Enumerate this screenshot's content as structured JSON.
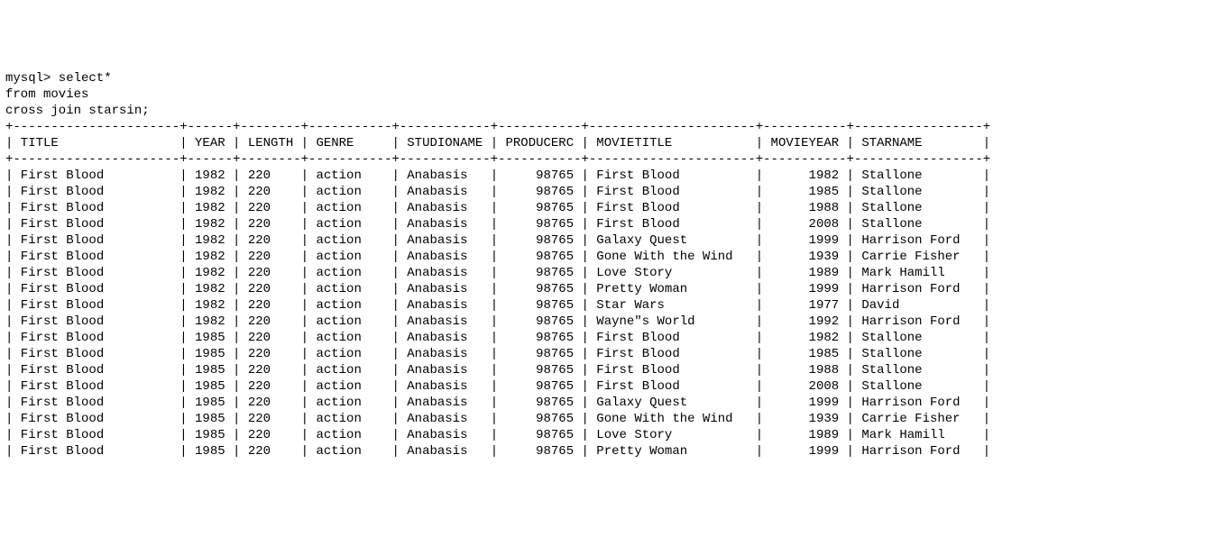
{
  "prompt": "mysql> ",
  "query_lines": [
    "select*",
    "from movies",
    "cross join starsin;"
  ],
  "columns": [
    {
      "name": "TITLE",
      "width": 20,
      "align": "left"
    },
    {
      "name": "YEAR",
      "width": 4,
      "align": "left"
    },
    {
      "name": "LENGTH",
      "width": 6,
      "align": "left"
    },
    {
      "name": "GENRE",
      "width": 9,
      "align": "left"
    },
    {
      "name": "STUDIONAME",
      "width": 10,
      "align": "left"
    },
    {
      "name": "PRODUCERC",
      "width": 9,
      "align": "right"
    },
    {
      "name": "MOVIETITLE",
      "width": 20,
      "align": "left"
    },
    {
      "name": "MOVIEYEAR",
      "width": 9,
      "align": "right"
    },
    {
      "name": "STARNAME",
      "width": 15,
      "align": "left"
    }
  ],
  "rows": [
    [
      "First Blood",
      "1982",
      "220",
      "action",
      "Anabasis",
      "98765",
      "First Blood",
      "1982",
      "Stallone"
    ],
    [
      "First Blood",
      "1982",
      "220",
      "action",
      "Anabasis",
      "98765",
      "First Blood",
      "1985",
      "Stallone"
    ],
    [
      "First Blood",
      "1982",
      "220",
      "action",
      "Anabasis",
      "98765",
      "First Blood",
      "1988",
      "Stallone"
    ],
    [
      "First Blood",
      "1982",
      "220",
      "action",
      "Anabasis",
      "98765",
      "First Blood",
      "2008",
      "Stallone"
    ],
    [
      "First Blood",
      "1982",
      "220",
      "action",
      "Anabasis",
      "98765",
      "Galaxy Quest",
      "1999",
      "Harrison Ford"
    ],
    [
      "First Blood",
      "1982",
      "220",
      "action",
      "Anabasis",
      "98765",
      "Gone With the Wind",
      "1939",
      "Carrie Fisher"
    ],
    [
      "First Blood",
      "1982",
      "220",
      "action",
      "Anabasis",
      "98765",
      "Love Story",
      "1989",
      "Mark Hamill"
    ],
    [
      "First Blood",
      "1982",
      "220",
      "action",
      "Anabasis",
      "98765",
      "Pretty Woman",
      "1999",
      "Harrison Ford"
    ],
    [
      "First Blood",
      "1982",
      "220",
      "action",
      "Anabasis",
      "98765",
      "Star Wars",
      "1977",
      "David"
    ],
    [
      "First Blood",
      "1982",
      "220",
      "action",
      "Anabasis",
      "98765",
      "Wayne\"s World",
      "1992",
      "Harrison Ford"
    ],
    [
      "First Blood",
      "1985",
      "220",
      "action",
      "Anabasis",
      "98765",
      "First Blood",
      "1982",
      "Stallone"
    ],
    [
      "First Blood",
      "1985",
      "220",
      "action",
      "Anabasis",
      "98765",
      "First Blood",
      "1985",
      "Stallone"
    ],
    [
      "First Blood",
      "1985",
      "220",
      "action",
      "Anabasis",
      "98765",
      "First Blood",
      "1988",
      "Stallone"
    ],
    [
      "First Blood",
      "1985",
      "220",
      "action",
      "Anabasis",
      "98765",
      "First Blood",
      "2008",
      "Stallone"
    ],
    [
      "First Blood",
      "1985",
      "220",
      "action",
      "Anabasis",
      "98765",
      "Galaxy Quest",
      "1999",
      "Harrison Ford"
    ],
    [
      "First Blood",
      "1985",
      "220",
      "action",
      "Anabasis",
      "98765",
      "Gone With the Wind",
      "1939",
      "Carrie Fisher"
    ],
    [
      "First Blood",
      "1985",
      "220",
      "action",
      "Anabasis",
      "98765",
      "Love Story",
      "1989",
      "Mark Hamill"
    ],
    [
      "First Blood",
      "1985",
      "220",
      "action",
      "Anabasis",
      "98765",
      "Pretty Woman",
      "1999",
      "Harrison Ford"
    ]
  ]
}
